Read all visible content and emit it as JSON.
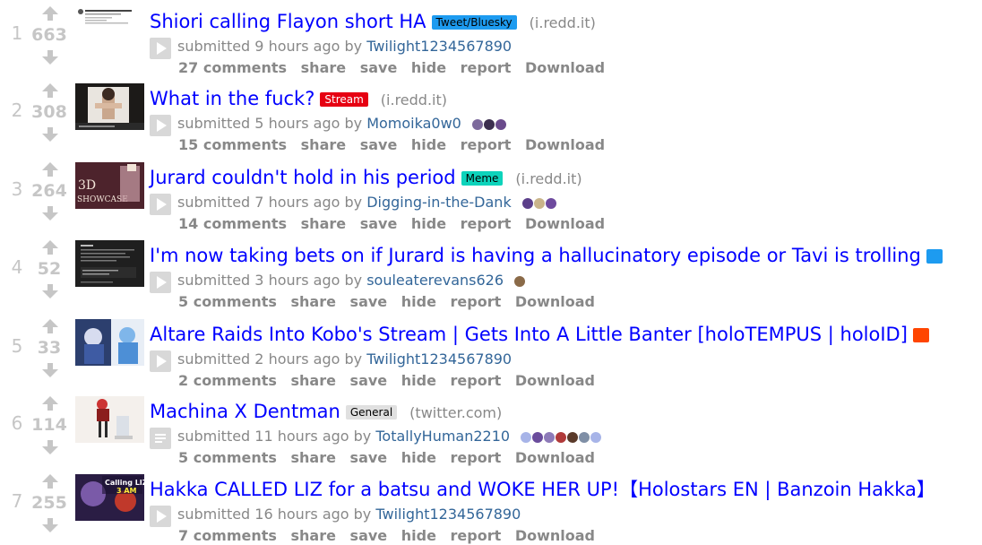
{
  "posts": [
    {
      "rank": "1",
      "score": "663",
      "title": "Shiori calling Flayon short HA",
      "flair": {
        "text": "Tweet/Bluesky",
        "bg": "#1d9bf0",
        "fg": "#000000"
      },
      "domain": "i.redd.it",
      "submitted": "submitted 9 hours ago by",
      "author": "Twilight1234567890",
      "comments": "27 comments",
      "thumb": {
        "type": "tweet"
      },
      "expando": "play-icon",
      "badges": []
    },
    {
      "rank": "2",
      "score": "308",
      "title": "What in the fuck?",
      "flair": {
        "text": "Stream",
        "bg": "#e60012",
        "fg": "#ffffff"
      },
      "domain": "i.redd.it",
      "submitted": "submitted 5 hours ago by",
      "author": "Momoika0w0",
      "comments": "15 comments",
      "thumb": {
        "type": "stream"
      },
      "expando": "play-icon",
      "badges": [
        "#7d6a9c",
        "#3c2f4f",
        "#6a4b8c"
      ]
    },
    {
      "rank": "3",
      "score": "264",
      "title": "Jurard couldn't hold in his period",
      "flair": {
        "text": "Meme",
        "bg": "#0dd3bb",
        "fg": "#000000"
      },
      "domain": "i.redd.it",
      "submitted": "submitted 7 hours ago by",
      "author": "Digging-in-the-Dank",
      "comments": "14 comments",
      "thumb": {
        "type": "showcase"
      },
      "expando": "play-icon",
      "badges": [
        "#5b3f8a",
        "#c9b48a",
        "#6e4a9e"
      ]
    },
    {
      "rank": "4",
      "score": "52",
      "title": "I'm now taking bets on if Jurard is having a hallucinatory episode or Tavi is trolling",
      "flair": {
        "text": "",
        "bg": "#1d9bf0",
        "fg": "#000000"
      },
      "domain": "",
      "submitted": "submitted 3 hours ago by",
      "author": "souleaterevans626",
      "comments": "5 comments",
      "thumb": {
        "type": "dark"
      },
      "expando": "play-icon",
      "badges": [
        "#8a6a48"
      ]
    },
    {
      "rank": "5",
      "score": "33",
      "title": "Altare Raids Into Kobo's Stream | Gets Into A Little Banter [holoTEMPUS | holoID]",
      "flair": {
        "text": "",
        "bg": "#ff4500",
        "fg": "#000000"
      },
      "domain": "",
      "submitted": "submitted 2 hours ago by",
      "author": "Twilight1234567890",
      "comments": "2 comments",
      "thumb": {
        "type": "altare"
      },
      "expando": "play-icon",
      "badges": []
    },
    {
      "rank": "6",
      "score": "114",
      "title": "Machina X Dentman",
      "flair": {
        "text": "General",
        "bg": "#e0e0e0",
        "fg": "#000000"
      },
      "domain": "twitter.com",
      "submitted": "submitted 11 hours ago by",
      "author": "TotallyHuman2210",
      "comments": "5 comments",
      "thumb": {
        "type": "figure"
      },
      "expando": "text-icon",
      "badges": [
        "#a7b4e8",
        "#6a4c9c",
        "#8d7ab8",
        "#b03a3a",
        "#5a3a2a",
        "#7f8fa6",
        "#a7b4e8"
      ]
    },
    {
      "rank": "7",
      "score": "255",
      "title": "Hakka CALLED LIZ for a batsu and WOKE HER UP!【Holostars EN | Banzoin Hakka】",
      "flair": {
        "text": "",
        "bg": "#ffffff",
        "fg": "#000000"
      },
      "domain": "",
      "submitted": "submitted 16 hours ago by",
      "author": "Twilight1234567890",
      "comments": "7 comments",
      "thumb": {
        "type": "hakka"
      },
      "expando": "play-icon",
      "badges": []
    }
  ],
  "actions": {
    "share": "share",
    "save": "save",
    "hide": "hide",
    "report": "report",
    "download": "Download"
  }
}
